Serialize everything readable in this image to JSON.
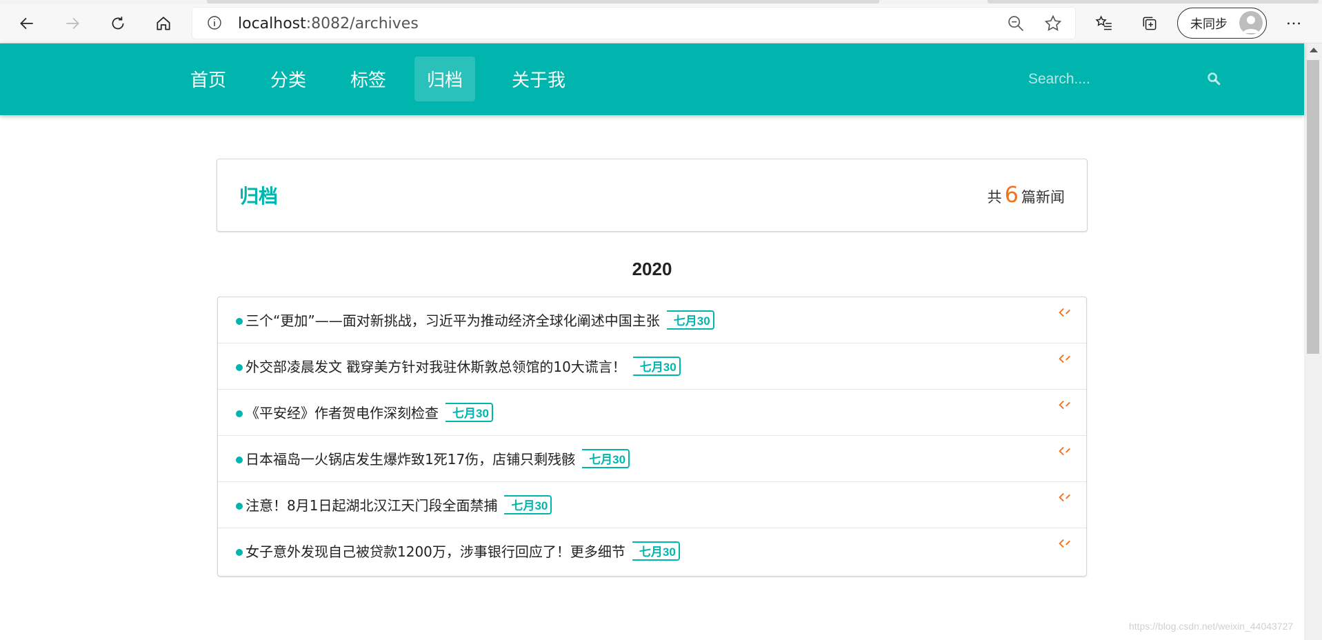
{
  "browser": {
    "url_host": "localhost",
    "url_rest": ":8082/archives",
    "sync_label": "未同步",
    "icons": [
      "back-icon",
      "forward-icon",
      "refresh-icon",
      "home-icon",
      "info-icon",
      "zoom-out-icon",
      "favorite-star-icon",
      "favorites-list-icon",
      "collections-icon",
      "more-icon"
    ]
  },
  "nav": {
    "items": [
      {
        "label": "首页"
      },
      {
        "label": "分类"
      },
      {
        "label": "标签"
      },
      {
        "label": "归档"
      },
      {
        "label": "关于我"
      }
    ],
    "active_index": 3,
    "search_placeholder": "Search....",
    "brand_color": "#00b5ad"
  },
  "header": {
    "title": "归档",
    "count_prefix": "共",
    "count": "6",
    "count_suffix": "篇新闻"
  },
  "year": "2020",
  "articles": [
    {
      "title": "三个“更加”——面对新挑战，习近平为推动经济全球化阐述中国主张",
      "date": "七月30"
    },
    {
      "title": "外交部凌晨发文 戳穿美方针对我驻休斯敦总领馆的10大谎言！",
      "date": "七月30"
    },
    {
      "title": "《平安经》作者贺电作深刻检查",
      "date": "七月30"
    },
    {
      "title": "日本福岛一火锅店发生爆炸致1死17伤，店铺只剩残骸",
      "date": "七月30"
    },
    {
      "title": "注意！8月1日起湖北汉江天门段全面禁捕",
      "date": "七月30"
    },
    {
      "title": "女子意外发现自己被贷款1200万，涉事银行回应了！更多细节",
      "date": "七月30"
    }
  ],
  "watermark": "https://blog.csdn.net/weixin_44043727"
}
